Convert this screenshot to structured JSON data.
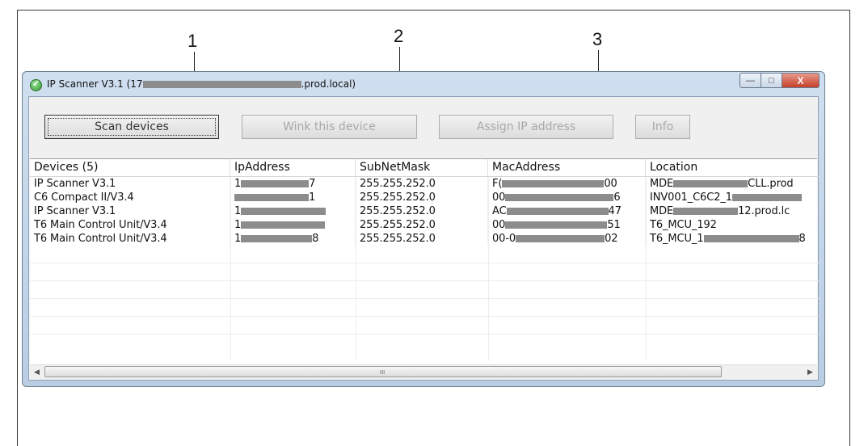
{
  "callouts": [
    "1",
    "2",
    "3"
  ],
  "window": {
    "title_prefix": "IP Scanner V3.1 (17",
    "title_suffix": ".prod.local)",
    "controls": {
      "minimize": "—",
      "maximize": "□",
      "close": "X"
    }
  },
  "toolbar": {
    "scan_label": "Scan devices",
    "wink_label": "Wink this device",
    "assign_label": "Assign IP address",
    "info_label": "Info"
  },
  "table": {
    "columns": [
      "Devices (5)",
      "IpAddress",
      "SubNetMask",
      "MacAddress",
      "Location"
    ],
    "rows": [
      {
        "device": "IP Scanner V3.1",
        "ip_pre": "1",
        "ip_post": "7",
        "mask": "255.255.252.0",
        "mac_pre": "F(",
        "mac_post": "00",
        "loc_pre": "MDE",
        "loc_post": "CLL.prod"
      },
      {
        "device": "C6 Compact II/V3.4",
        "ip_pre": "",
        "ip_post": "1",
        "mask": "255.255.252.0",
        "mac_pre": "00",
        "mac_post": "6",
        "loc_pre": "INV001_C6C2_1",
        "loc_post": ""
      },
      {
        "device": "IP Scanner V3.1",
        "ip_pre": "1",
        "ip_post": "",
        "mask": "255.255.252.0",
        "mac_pre": "AC",
        "mac_post": "47",
        "loc_pre": "MDE",
        "loc_post": "12.prod.lc"
      },
      {
        "device": "T6 Main Control Unit/V3.4",
        "ip_pre": "1",
        "ip_post": "",
        "mask": "255.255.252.0",
        "mac_pre": "00",
        "mac_post": "51",
        "loc_pre": "T6_MCU_192",
        "loc_post": ""
      },
      {
        "device": "T6 Main Control Unit/V3.4",
        "ip_pre": "1",
        "ip_post": "8",
        "mask": "255.255.252.0",
        "mac_pre": "00-0",
        "mac_post": "02",
        "loc_pre": "T6_MCU_1",
        "loc_post": "8"
      }
    ]
  },
  "scrollbar": {
    "left_arrow": "◀",
    "right_arrow": "▶",
    "grip": "III"
  }
}
